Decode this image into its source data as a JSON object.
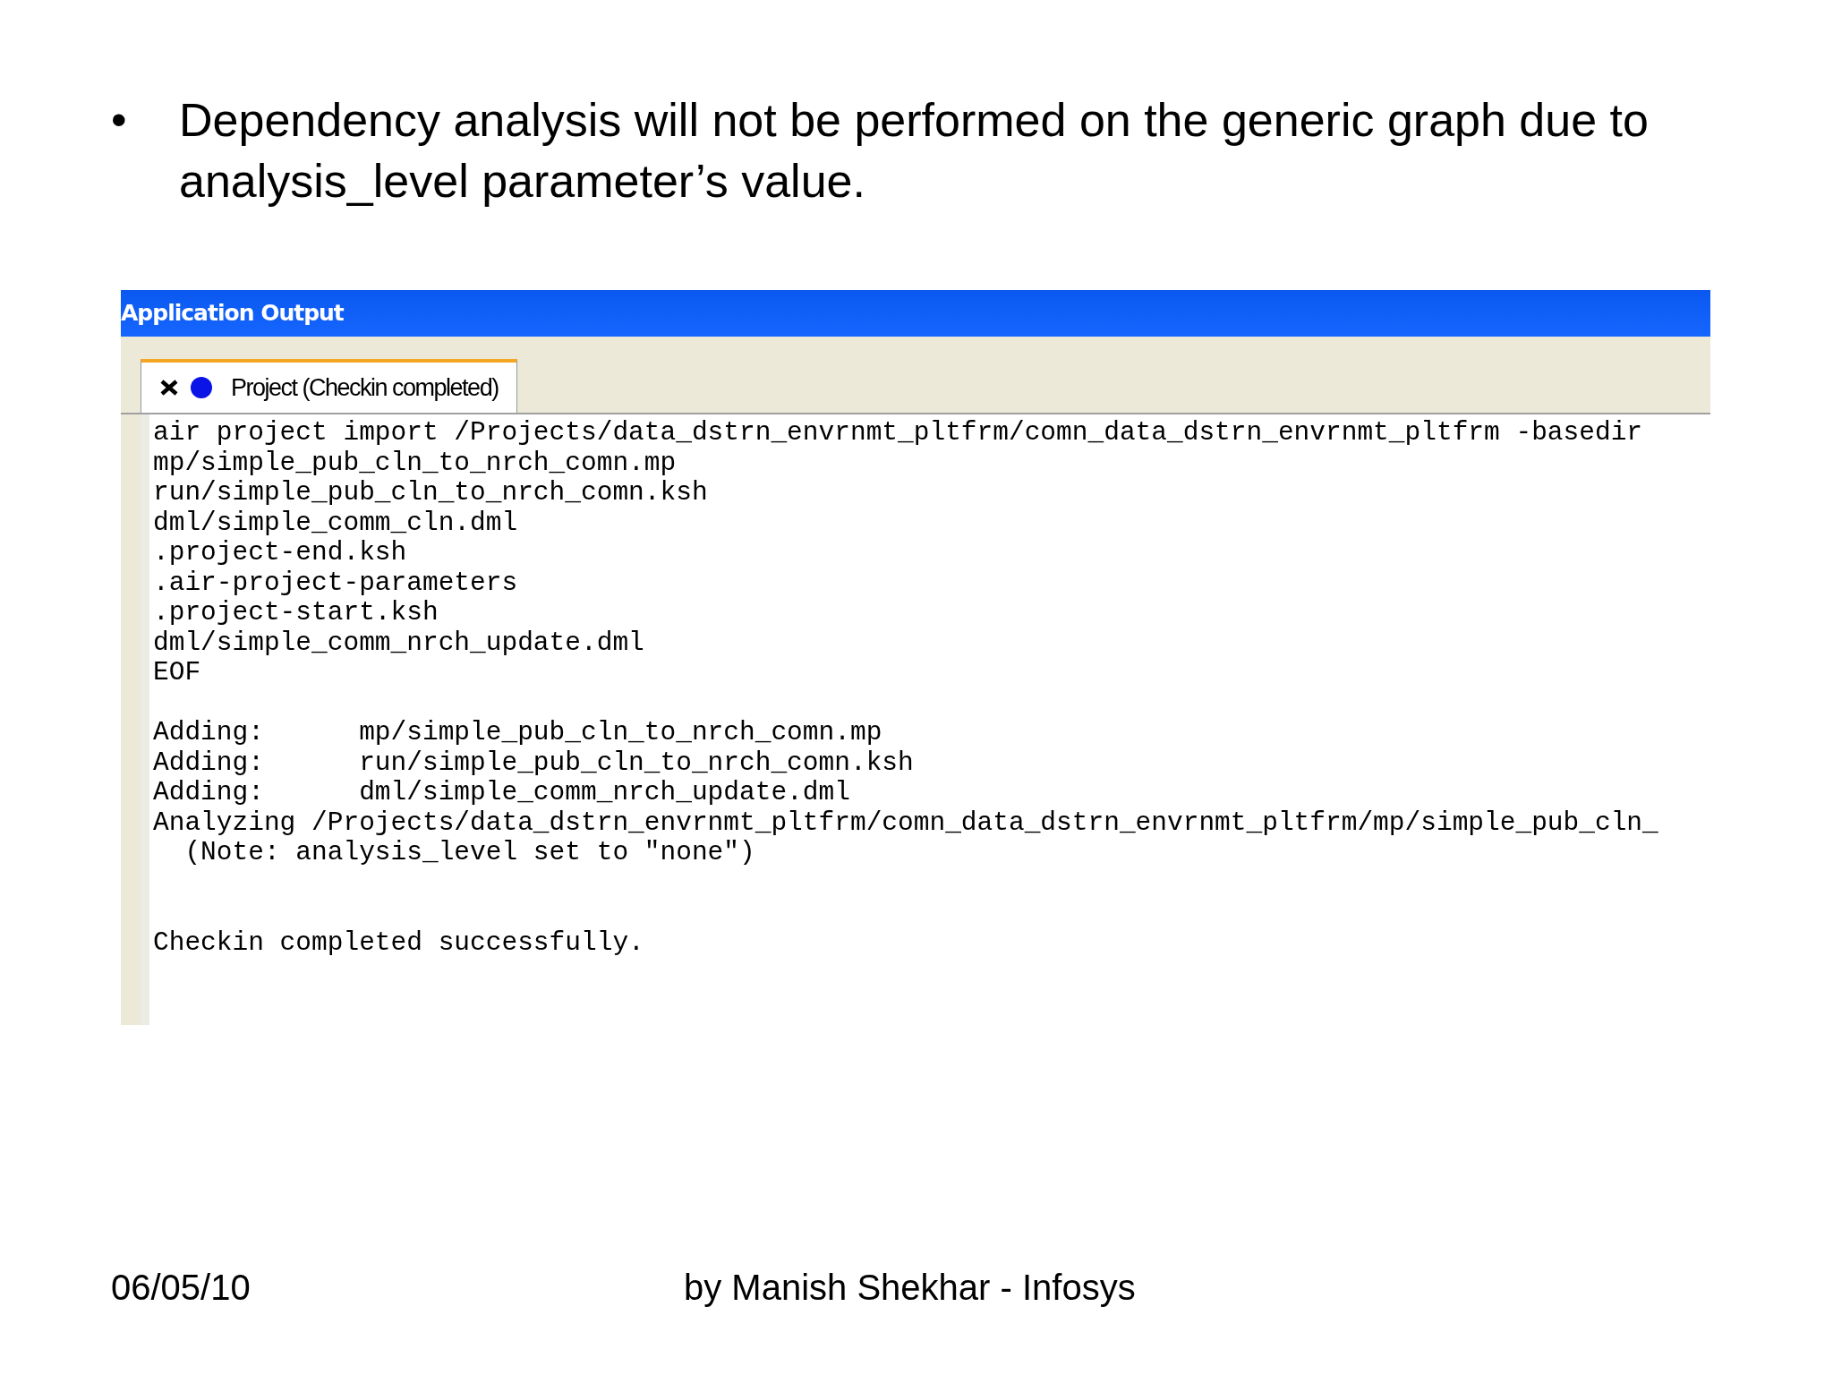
{
  "slide": {
    "bullet": "•",
    "text": "Dependency analysis will not be performed on the generic graph due to analysis_level parameter’s value."
  },
  "window": {
    "title": "Application Output"
  },
  "tabs": [
    {
      "label": "Project (Checkin completed)",
      "selected": true
    }
  ],
  "output": "air project import /Projects/data_dstrn_envrnmt_pltfrm/comn_data_dstrn_envrnmt_pltfrm -basedir\nmp/simple_pub_cln_to_nrch_comn.mp\nrun/simple_pub_cln_to_nrch_comn.ksh\ndml/simple_comm_cln.dml\n.project-end.ksh\n.air-project-parameters\n.project-start.ksh\ndml/simple_comm_nrch_update.dml\nEOF\n\nAdding:      mp/simple_pub_cln_to_nrch_comn.mp\nAdding:      run/simple_pub_cln_to_nrch_comn.ksh\nAdding:      dml/simple_comm_nrch_update.dml\nAnalyzing /Projects/data_dstrn_envrnmt_pltfrm/comn_data_dstrn_envrnmt_pltfrm/mp/simple_pub_cln_\n  (Note: analysis_level set to \"none\")\n\n\nCheckin completed successfully.",
  "footer": {
    "date": "06/05/10",
    "author": "by Manish Shekhar - Infosys"
  }
}
